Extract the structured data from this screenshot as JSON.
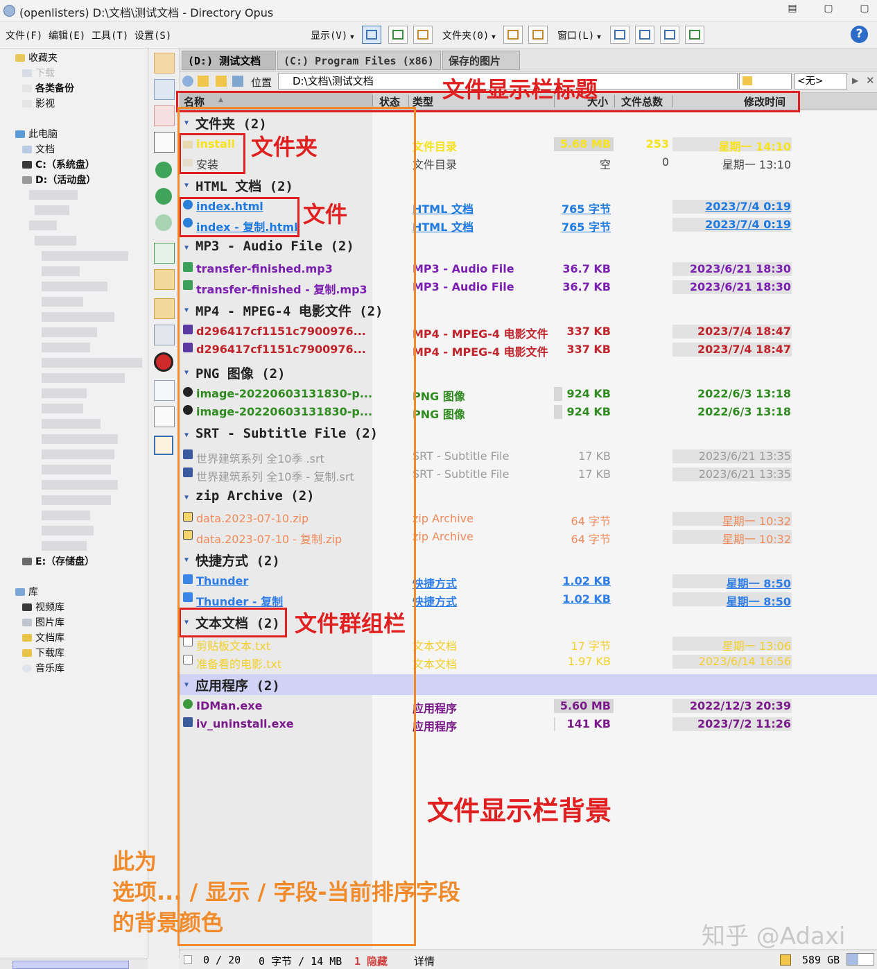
{
  "window": {
    "title": "(openlisters) D:\\文档\\测试文档 - Directory Opus",
    "controls": [
      "▤",
      "▢",
      "▢"
    ]
  },
  "menu": {
    "file": "文件(F)",
    "edit": "编辑(E)",
    "tools": "工具(T)",
    "settings": "设置(S)",
    "display": "显示(V)",
    "folders": "文件夹(0)",
    "window": "窗口(L)",
    "help": "?"
  },
  "tree": {
    "favorites": "收藏夹",
    "downloads": "下载",
    "backups": "各类备份",
    "movies": "影视",
    "this_pc": "此电脑",
    "documents": "文档",
    "drive_c": "C:（系统盘）",
    "drive_d": "D:（活动盘）",
    "drive_e": "E:（存储盘）",
    "library": "库",
    "lib_video": "视频库",
    "lib_pictures": "图片库",
    "lib_docs": "文档库",
    "lib_downloads": "下载库",
    "lib_music": "音乐库"
  },
  "tabs": [
    "(D:) 测试文档",
    "(C:) Program Files (x86)",
    "保存的图片"
  ],
  "pathbar": {
    "location_label": "位置",
    "path": "D:\\文档\\测试文档",
    "filter": "<无>"
  },
  "columns": {
    "name": "名称",
    "status": "状态",
    "type": "类型",
    "size": "大小",
    "count": "文件总数",
    "modified": "修改时间"
  },
  "groups": [
    {
      "label": "文件夹 (2)",
      "rows": [
        {
          "name": "install",
          "type": "文件目录",
          "size": "5.68 MB",
          "count": "253",
          "date": "星期一",
          "time": "14:10"
        },
        {
          "name": "安装",
          "type": "文件目录",
          "size": "空",
          "count": "0",
          "date": "星期一",
          "time": "13:10"
        }
      ]
    },
    {
      "label": "HTML 文档 (2)",
      "rows": [
        {
          "name": "index.html",
          "type": "HTML 文档",
          "size": "765 字节",
          "date": "2023/7/4",
          "time": "0:19"
        },
        {
          "name": "index - 复制.html",
          "type": "HTML 文档",
          "size": "765 字节",
          "date": "2023/7/4",
          "time": "0:19"
        }
      ]
    },
    {
      "label": "MP3 - Audio File (2)",
      "rows": [
        {
          "name": "transfer-finished.mp3",
          "type": "MP3 - Audio File",
          "size": "36.7 KB",
          "date": "2023/6/21",
          "time": "18:30"
        },
        {
          "name": "transfer-finished - 复制.mp3",
          "type": "MP3 - Audio File",
          "size": "36.7 KB",
          "date": "2023/6/21",
          "time": "18:30"
        }
      ]
    },
    {
      "label": "MP4 - MPEG-4 电影文件 (2)",
      "rows": [
        {
          "name": "d296417cf1151c7900976...",
          "type": "MP4 - MPEG-4 电影文件",
          "size": "337 KB",
          "date": "2023/7/4",
          "time": "18:47"
        },
        {
          "name": "d296417cf1151c7900976...",
          "type": "MP4 - MPEG-4 电影文件",
          "size": "337 KB",
          "date": "2023/7/4",
          "time": "18:47"
        }
      ]
    },
    {
      "label": "PNG 图像 (2)",
      "rows": [
        {
          "name": "image-20220603131830-p...",
          "type": "PNG 图像",
          "size": "924 KB",
          "date": "2022/6/3",
          "time": "13:18"
        },
        {
          "name": "image-20220603131830-p...",
          "type": "PNG 图像",
          "size": "924 KB",
          "date": "2022/6/3",
          "time": "13:18"
        }
      ]
    },
    {
      "label": "SRT - Subtitle File (2)",
      "rows": [
        {
          "name": "世界建筑系列 全10季 .srt",
          "type": "SRT - Subtitle File",
          "size": "17 KB",
          "date": "2023/6/21",
          "time": "13:35"
        },
        {
          "name": "世界建筑系列 全10季 - 复制.srt",
          "type": "SRT - Subtitle File",
          "size": "17 KB",
          "date": "2023/6/21",
          "time": "13:35"
        }
      ]
    },
    {
      "label": "zip Archive (2)",
      "rows": [
        {
          "name": "data.2023-07-10.zip",
          "type": "zip Archive",
          "size": "64 字节",
          "date": "星期一",
          "time": "10:32"
        },
        {
          "name": "data.2023-07-10 - 复制.zip",
          "type": "zip Archive",
          "size": "64 字节",
          "date": "星期一",
          "time": "10:32"
        }
      ]
    },
    {
      "label": "快捷方式 (2)",
      "rows": [
        {
          "name": "Thunder",
          "type": "快捷方式",
          "size": "1.02 KB",
          "date": "星期一",
          "time": "8:50"
        },
        {
          "name": "Thunder - 复制",
          "type": "快捷方式",
          "size": "1.02 KB",
          "date": "星期一",
          "time": "8:50"
        }
      ]
    },
    {
      "label": "文本文档 (2)",
      "rows": [
        {
          "name": "剪贴板文本.txt",
          "type": "文本文档",
          "size": "17 字节",
          "date": "星期一",
          "time": "13:06"
        },
        {
          "name": "准备看的电影.txt",
          "type": "文本文档",
          "size": "1.97 KB",
          "date": "2023/6/14",
          "time": "16:56"
        }
      ]
    },
    {
      "label": "应用程序 (2)",
      "rows": [
        {
          "name": "IDMan.exe",
          "type": "应用程序",
          "size": "5.60 MB",
          "date": "2022/12/3",
          "time": "20:39"
        },
        {
          "name": "iv_uninstall.exe",
          "type": "应用程序",
          "size": "141 KB",
          "date": "2023/7/2",
          "time": "11:26"
        }
      ]
    }
  ],
  "status": {
    "selected": "0 / 20",
    "bytes": "0 字节 / 14 MB",
    "hidden": "1 隐藏",
    "details": "详情",
    "free": "589 GB"
  },
  "annotations": {
    "header_title": "文件显示栏标题",
    "folder": "文件夹",
    "file": "文件",
    "group_bar": "文件群组栏",
    "background": "文件显示栏背景",
    "sort_note_1": "此为",
    "sort_note_2": "选项... / 显示 / 字段-当前排序字段",
    "sort_note_3": "的背景颜色"
  },
  "watermark": "知乎 @Adaxi",
  "colors": {
    "folder_sel": "#f7e21e",
    "folder": "#444444",
    "html": "#1f7ae0",
    "mp3": "#7a1fb0",
    "mp4": "#c0232a",
    "png": "#2f8a1f",
    "srt": "#9a9a9a",
    "zip": "#f08a5a",
    "shortcut": "#2f7ee8",
    "txt": "#f2cf2a",
    "exe": "#7a1a8a",
    "annotation_red": "#e02020",
    "annotation_orange": "#f08a2a"
  }
}
